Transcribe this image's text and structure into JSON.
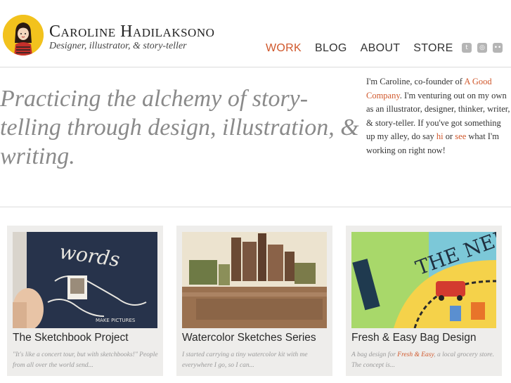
{
  "header": {
    "site_title": "Caroline Hadilaksono",
    "tagline": "Designer, illustrator, & story-teller",
    "nav": [
      {
        "label": "WORK",
        "active": true
      },
      {
        "label": "BLOG",
        "active": false
      },
      {
        "label": "ABOUT",
        "active": false
      },
      {
        "label": "STORE",
        "active": false
      }
    ],
    "social_icons": [
      "twitter-icon",
      "dribbble-icon",
      "flickr-icon"
    ]
  },
  "hero": {
    "headline": "Practicing the alchemy of story-telling through design, illustration, & writing."
  },
  "intro": {
    "text_1": "I'm Caroline, co-founder of ",
    "link_company": "A Good Company",
    "text_2": ". I'm venturing out on my own as an illustrator, designer, thinker, writer, & story-teller. If you've got something up my alley, do say ",
    "link_hi": "hi",
    "text_3": " or ",
    "link_see": "see",
    "text_4": " what I'm working on right now!"
  },
  "cards": [
    {
      "title": "The Sketchbook Project",
      "excerpt_1": "\"It's like a concert tour, but with sketchbooks!\" People from all over the world send...",
      "thumb_label": "words",
      "thumb_subtext": "MAKE PICTURES"
    },
    {
      "title": "Watercolor Sketches Series",
      "excerpt_1": "I started carrying a tiny watercolor kit with me everywhere I go, so I can..."
    },
    {
      "title": "Fresh & Easy Bag Design",
      "excerpt_1": "A bag design for ",
      "excerpt_link": "Fresh & Easy",
      "excerpt_2": ", a local grocery store. The concept is...",
      "thumb_label": "THE NEIGHB"
    }
  ],
  "colors": {
    "accent": "#d0582c",
    "card_bg": "#eeedeb",
    "hero_text": "#8a8a8a",
    "logo_bg": "#f2c21d"
  }
}
